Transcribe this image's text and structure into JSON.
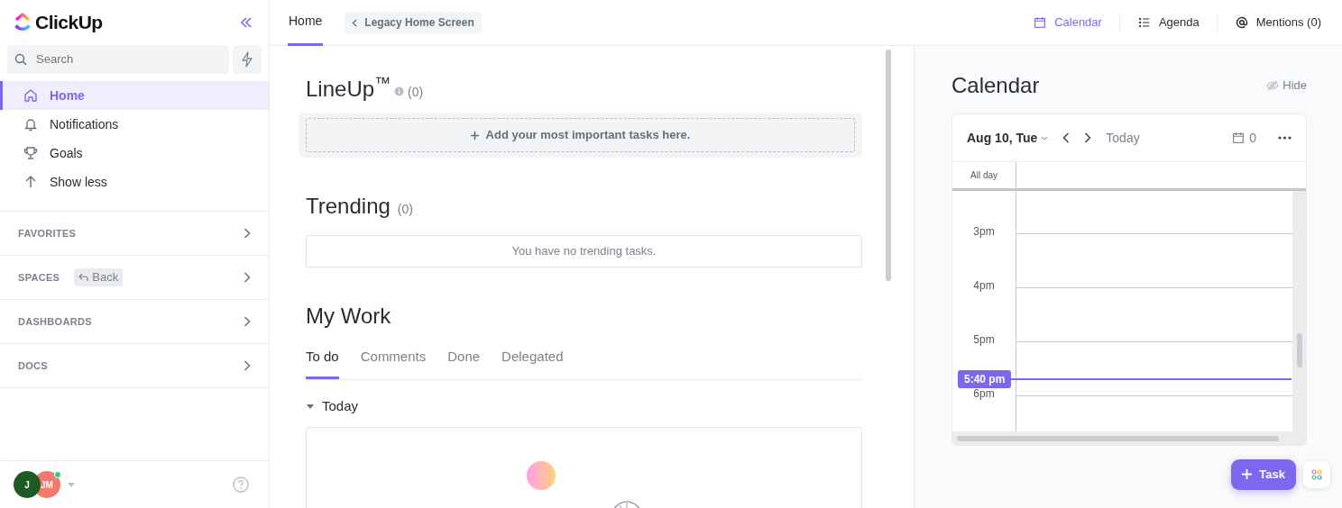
{
  "sidebar": {
    "logo": "ClickUp",
    "search": {
      "placeholder": "Search"
    },
    "nav": [
      {
        "label": "Home",
        "selected": true
      },
      {
        "label": "Notifications",
        "selected": false
      },
      {
        "label": "Goals",
        "selected": false
      },
      {
        "label": "Show less",
        "selected": false
      }
    ],
    "sections": [
      {
        "label": "FAVORITES"
      },
      {
        "label": "SPACES",
        "button": "Back"
      },
      {
        "label": "DASHBOARDS"
      },
      {
        "label": "DOCS"
      }
    ],
    "avatars": [
      {
        "initials": "J",
        "color": "#1e5a25",
        "online": false
      },
      {
        "initials": "JM",
        "color": "#f3796c",
        "online": true
      }
    ]
  },
  "header": {
    "tabs": [
      {
        "label": "Home",
        "selected": true
      }
    ],
    "legacy_button": "Legacy Home Screen",
    "views": [
      {
        "label": "Calendar",
        "selected": true
      },
      {
        "label": "Agenda",
        "selected": false
      },
      {
        "label": "Mentions (0)",
        "selected": false
      }
    ]
  },
  "lineup": {
    "title": "LineUp$^{™}$",
    "count": "(0)",
    "add_text": "Add your most important tasks here."
  },
  "trending": {
    "title": "Trending",
    "count": "(0)",
    "empty_text": "You have no trending tasks."
  },
  "my_work": {
    "title": "My Work",
    "tabs": [
      {
        "label": "To do",
        "selected": true
      },
      {
        "label": "Comments",
        "selected": false
      },
      {
        "label": "Done",
        "selected": false
      },
      {
        "label": "Delegated",
        "selected": false
      }
    ],
    "group": {
      "label": "Today",
      "expanded": true
    }
  },
  "calendar": {
    "title": "Calendar",
    "hide": "Hide",
    "date": "Aug 10, Tue",
    "today": "Today",
    "count": "0",
    "all_day": "All day",
    "hours": [
      "3pm",
      "4pm",
      "5pm",
      "6pm"
    ],
    "now": "5:40 pm"
  },
  "fab": {
    "label": "Task"
  }
}
